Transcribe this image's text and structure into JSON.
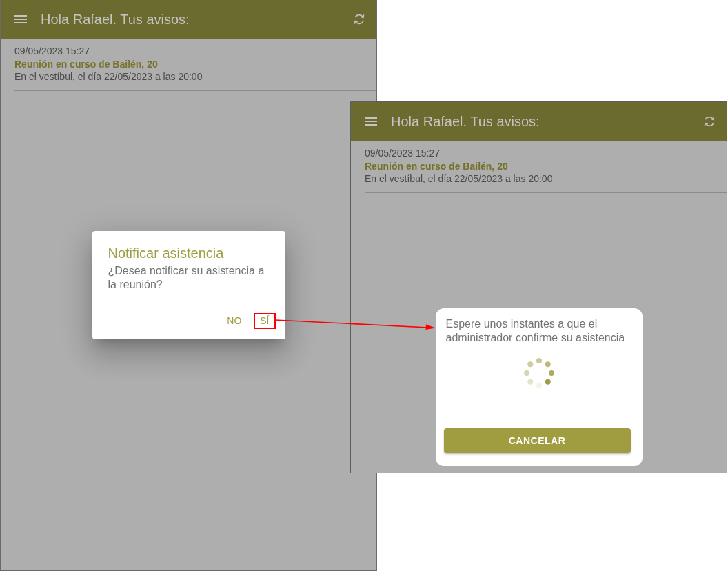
{
  "screens": [
    {
      "header": {
        "title": "Hola Rafael. Tus avisos:"
      },
      "notices": [
        {
          "date": "09/05/2023 15:27",
          "title": "Reunión en curso de Bailén, 20",
          "detail": "En el vestíbul, el día 22/05/2023 a las 20:00"
        }
      ],
      "dialog": {
        "kind": "confirm",
        "title": "Notificar asistencia",
        "message": "¿Desea notificar su asistencia a la reunión?",
        "buttons": [
          {
            "label": "NO",
            "highlighted": false
          },
          {
            "label": "SÍ",
            "highlighted": true
          }
        ]
      }
    },
    {
      "header": {
        "title": "Hola Rafael. Tus avisos:"
      },
      "notices": [
        {
          "date": "09/05/2023 15:27",
          "title": "Reunión en curso de Bailén, 20",
          "detail": "En el vestíbul, el día 22/05/2023 a las 20:00"
        }
      ],
      "dialog": {
        "kind": "waiting",
        "message": "Espere unos instantes a que el administrador confirme su asistencia",
        "buttons": [
          {
            "label": "CANCELAR",
            "highlighted": false
          }
        ]
      }
    }
  ]
}
